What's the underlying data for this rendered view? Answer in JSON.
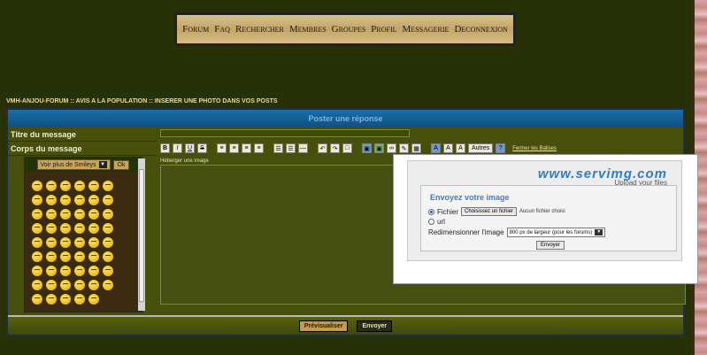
{
  "nav": {
    "items": [
      "Forum",
      "Faq",
      "Rechercher",
      "Membres",
      "Groupes",
      "Profil",
      "Messagerie",
      "Deconnexion"
    ]
  },
  "breadcrumb": "VMH-ANJOU-FORUM :: AVIS A LA POPULATION :: INSERER UNE PHOTO DANS VOS POSTS",
  "post": {
    "header": "Poster une réponse",
    "title_label": "Titre du message",
    "body_label": "Corps du message",
    "smiley_select": "Voir plus de Smileys",
    "ok": "Ok",
    "heberger": "Héberger une image",
    "autres": "Autres",
    "fermer": "Fermer les Balises",
    "preview": "Prévisualiser",
    "send": "Envoyer",
    "toolbar_labels": [
      "B",
      "I",
      "U",
      "S"
    ]
  },
  "servimg": {
    "brand": "www.servimg.com",
    "tagline": "Upload your files",
    "title": "Envoyez votre image",
    "fichier_label": "Fichier",
    "choose_button": "Choisissez un fichier",
    "no_file": "Aucun fichier choisi",
    "url_label": "url",
    "resize_label": "Redimensionner l'image",
    "resize_value": "800 px de largeur (pour les forums)",
    "submit": "Envoyer"
  },
  "colors": {
    "page_bg": "#283005",
    "header_blue": "#1e6da6",
    "servimg_blue": "#2f7dc9"
  }
}
